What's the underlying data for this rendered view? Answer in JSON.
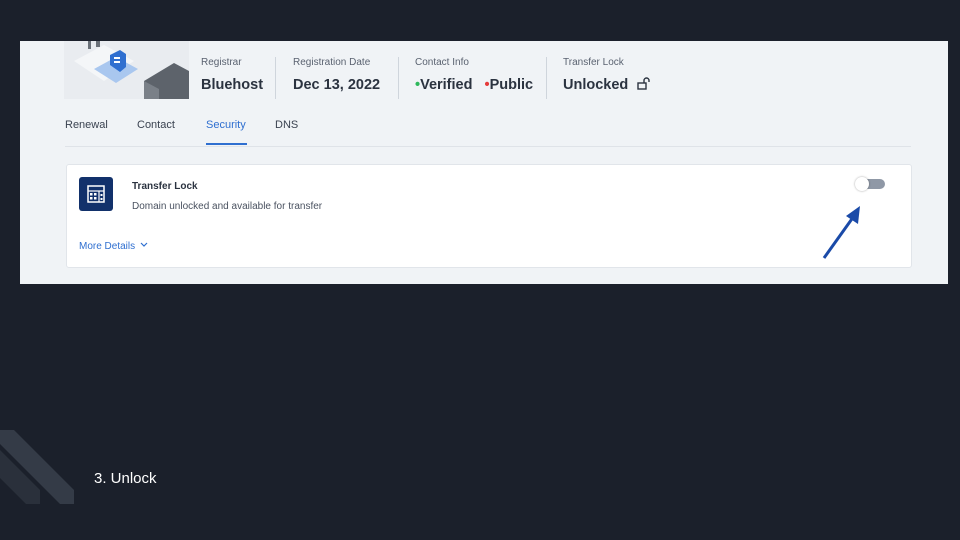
{
  "header": {
    "registrar": {
      "label": "Registrar",
      "value": "Bluehost"
    },
    "registration_date": {
      "label": "Registration Date",
      "value": "Dec 13, 2022"
    },
    "contact_info": {
      "label": "Contact Info",
      "verified_dot": "•",
      "verified": "Verified",
      "public_dot": "•",
      "public": "Public"
    },
    "transfer_lock": {
      "label": "Transfer Lock",
      "value": "Unlocked",
      "icon": "unlock-icon"
    }
  },
  "tabs": [
    {
      "label": "Renewal",
      "active": false
    },
    {
      "label": "Contact",
      "active": false
    },
    {
      "label": "Security",
      "active": true
    },
    {
      "label": "DNS",
      "active": false
    }
  ],
  "card": {
    "title": "Transfer Lock",
    "description": "Domain unlocked and available for transfer",
    "more_details": "More Details",
    "icon": "building-icon",
    "toggle_on": false
  },
  "caption": "3. Unlock",
  "colors": {
    "accent": "#2f6fd0",
    "verified": "#2eb85c",
    "public": "#e53b3b",
    "arrow": "#1a4aa8",
    "slide_bg": "#1b202b"
  }
}
